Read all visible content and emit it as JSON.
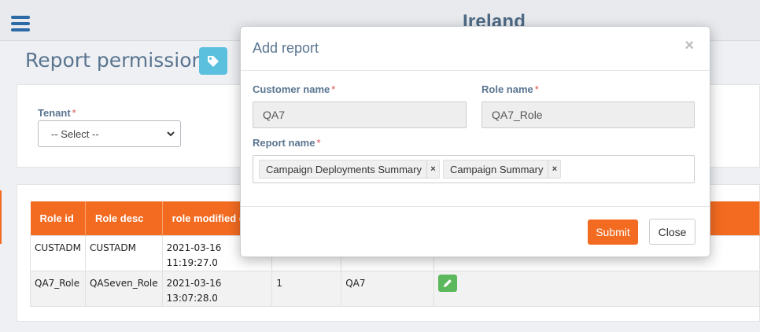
{
  "header": {
    "menu_icon": "hamburger-icon",
    "region": "Ireland"
  },
  "page": {
    "title": "Report permissions",
    "tag_icon": "tag-icon"
  },
  "filter": {
    "tenant_label": "Tenant",
    "required_mark": "*",
    "tenant_value": "-- Select --"
  },
  "table": {
    "headers": [
      "Role id",
      "Role desc",
      "role modified da"
    ],
    "rows": [
      {
        "role_id": "CUSTADM",
        "role_desc": "CUSTADM",
        "modified_date": "2021-03-16",
        "modified_time": "11:19:27.0",
        "col4": "",
        "col5": ""
      },
      {
        "role_id": "QA7_Role",
        "role_desc": "QASeven_Role",
        "modified_date": "2021-03-16",
        "modified_time": "13:07:28.0",
        "col4": "1",
        "col5": "QA7"
      }
    ],
    "edit_icon": "pencil-icon"
  },
  "modal": {
    "title": "Add report",
    "close_symbol": "×",
    "customer_name_label": "Customer name",
    "customer_name_value": "QA7",
    "role_name_label": "Role name",
    "role_name_value": "QA7_Role",
    "report_name_label": "Report name",
    "required_mark": "*",
    "selected_reports": [
      "Campaign Deployments Summary",
      "Campaign Summary"
    ],
    "chip_remove_symbol": "×",
    "submit_label": "Submit",
    "close_label": "Close"
  },
  "colors": {
    "accent": "#f26b21",
    "info": "#5bc0de",
    "success": "#5cb85c",
    "title": "#5a7590"
  }
}
